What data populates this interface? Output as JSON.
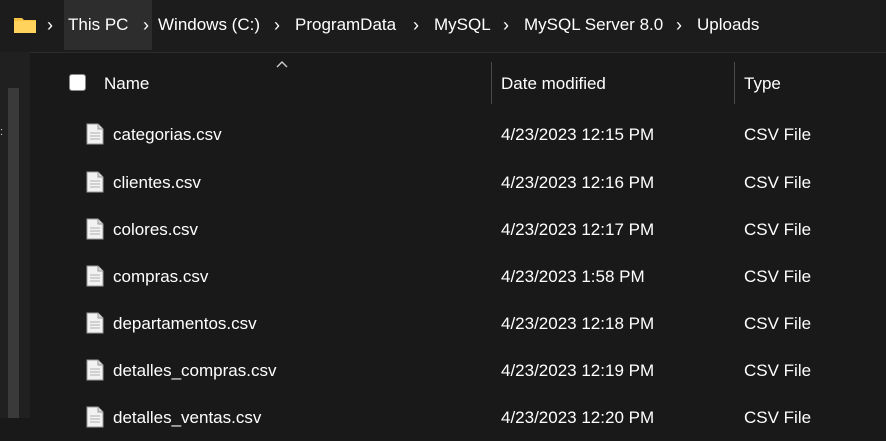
{
  "address_bar": {
    "breadcrumbs": [
      "This PC",
      "Windows (C:)",
      "ProgramData",
      "MySQL",
      "MySQL Server 8.0",
      "Uploads"
    ]
  },
  "columns": {
    "name": "Name",
    "date_modified": "Date modified",
    "type": "Type"
  },
  "files": [
    {
      "name": "categorias.csv",
      "date": "4/23/2023 12:15 PM",
      "type": "CSV File"
    },
    {
      "name": "clientes.csv",
      "date": "4/23/2023 12:16 PM",
      "type": "CSV File"
    },
    {
      "name": "colores.csv",
      "date": "4/23/2023 12:17 PM",
      "type": "CSV File"
    },
    {
      "name": "compras.csv",
      "date": "4/23/2023 1:58 PM",
      "type": "CSV File"
    },
    {
      "name": "departamentos.csv",
      "date": "4/23/2023 12:18 PM",
      "type": "CSV File"
    },
    {
      "name": "detalles_compras.csv",
      "date": "4/23/2023 12:19 PM",
      "type": "CSV File"
    },
    {
      "name": "detalles_ventas.csv",
      "date": "4/23/2023 12:20 PM",
      "type": "CSV File"
    }
  ],
  "colors": {
    "background": "#191919",
    "folder": "#f5c242",
    "text": "#ffffff"
  },
  "icons": [
    "folder-icon",
    "chevron-right-icon",
    "sort-up-icon",
    "file-icon"
  ]
}
